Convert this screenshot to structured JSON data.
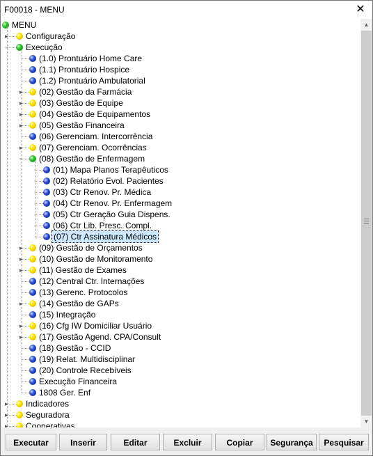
{
  "window": {
    "title": "F00018 - MENU",
    "close_glyph": "✕"
  },
  "tree": {
    "root": "MENU",
    "items": [
      {
        "label": "Configuração",
        "color": "yellow",
        "level": 1,
        "expander": true
      },
      {
        "label": "Execução",
        "color": "green",
        "level": 1,
        "expander": true,
        "expanded": true
      },
      {
        "label": "(1.0) Prontuário Home Care",
        "color": "blue",
        "level": 2
      },
      {
        "label": "(1.1) Prontuário Hospice",
        "color": "blue",
        "level": 2
      },
      {
        "label": "(1.2) Prontuário Ambulatorial",
        "color": "blue",
        "level": 2
      },
      {
        "label": "(02) Gestão da Farmácia",
        "color": "yellow",
        "level": 2,
        "expander": true
      },
      {
        "label": "(03) Gestão de Equipe",
        "color": "yellow",
        "level": 2,
        "expander": true
      },
      {
        "label": "(04) Gestão de Equipamentos",
        "color": "yellow",
        "level": 2,
        "expander": true
      },
      {
        "label": "(05) Gestão Financeira",
        "color": "yellow",
        "level": 2,
        "expander": true
      },
      {
        "label": "(06) Gerenciam. Intercorrência",
        "color": "blue",
        "level": 2
      },
      {
        "label": "(07) Gerenciam. Ocorrências",
        "color": "yellow",
        "level": 2,
        "expander": true
      },
      {
        "label": "(08) Gestão de Enfermagem",
        "color": "green",
        "level": 2,
        "expander": true,
        "expanded": true
      },
      {
        "label": "(01) Mapa Planos Terapêuticos",
        "color": "blue",
        "level": 3
      },
      {
        "label": "(02) Relatório Evol. Pacientes",
        "color": "blue",
        "level": 3
      },
      {
        "label": "(03) Ctr Renov. Pr. Médica",
        "color": "blue",
        "level": 3
      },
      {
        "label": "(04) Ctr Renov. Pr. Enfermagem",
        "color": "blue",
        "level": 3
      },
      {
        "label": "(05) Ctr Geração Guia Dispens.",
        "color": "blue",
        "level": 3
      },
      {
        "label": "(06) Ctr Lib. Presc. Compl.",
        "color": "blue",
        "level": 3
      },
      {
        "label": "(07) Ctr Assinatura Médicos",
        "color": "blue",
        "level": 3,
        "selected": true
      },
      {
        "label": "(09) Gestão de Orçamentos",
        "color": "yellow",
        "level": 2,
        "expander": true
      },
      {
        "label": "(10) Gestão de Monitoramento",
        "color": "yellow",
        "level": 2,
        "expander": true
      },
      {
        "label": "(11) Gestão de Exames",
        "color": "yellow",
        "level": 2,
        "expander": true
      },
      {
        "label": "(12) Central Ctr. Internações",
        "color": "blue",
        "level": 2
      },
      {
        "label": "(13) Gerenc. Protocolos",
        "color": "blue",
        "level": 2
      },
      {
        "label": "(14) Gestão de GAPs",
        "color": "yellow",
        "level": 2,
        "expander": true
      },
      {
        "label": "(15) Integração",
        "color": "blue",
        "level": 2
      },
      {
        "label": "(16) Cfg IW Domiciliar Usuário",
        "color": "yellow",
        "level": 2,
        "expander": true
      },
      {
        "label": "(17) Gestão Agend. CPA/Consult",
        "color": "yellow",
        "level": 2,
        "expander": true
      },
      {
        "label": "(18) Gestão - CCID",
        "color": "blue",
        "level": 2
      },
      {
        "label": "(19) Relat. Multidisciplinar",
        "color": "blue",
        "level": 2
      },
      {
        "label": "(20) Controle Recebíveis",
        "color": "blue",
        "level": 2
      },
      {
        "label": "Execução Financeira",
        "color": "blue",
        "level": 2
      },
      {
        "label": "1808 Ger. Enf",
        "color": "blue",
        "level": 2
      },
      {
        "label": "Indicadores",
        "color": "yellow",
        "level": 1,
        "expander": true
      },
      {
        "label": "Seguradora",
        "color": "yellow",
        "level": 1,
        "expander": true
      },
      {
        "label": "Cooperativas",
        "color": "yellow",
        "level": 1,
        "expander": true
      }
    ]
  },
  "scrollbar": {
    "up_glyph": "▲",
    "down_glyph": "▼"
  },
  "buttons": {
    "executar": "Executar",
    "inserir": "Inserir",
    "editar": "Editar",
    "excluir": "Excluir",
    "copiar": "Copiar",
    "seguranca": "Segurança",
    "pesquisar": "Pesquisar"
  }
}
